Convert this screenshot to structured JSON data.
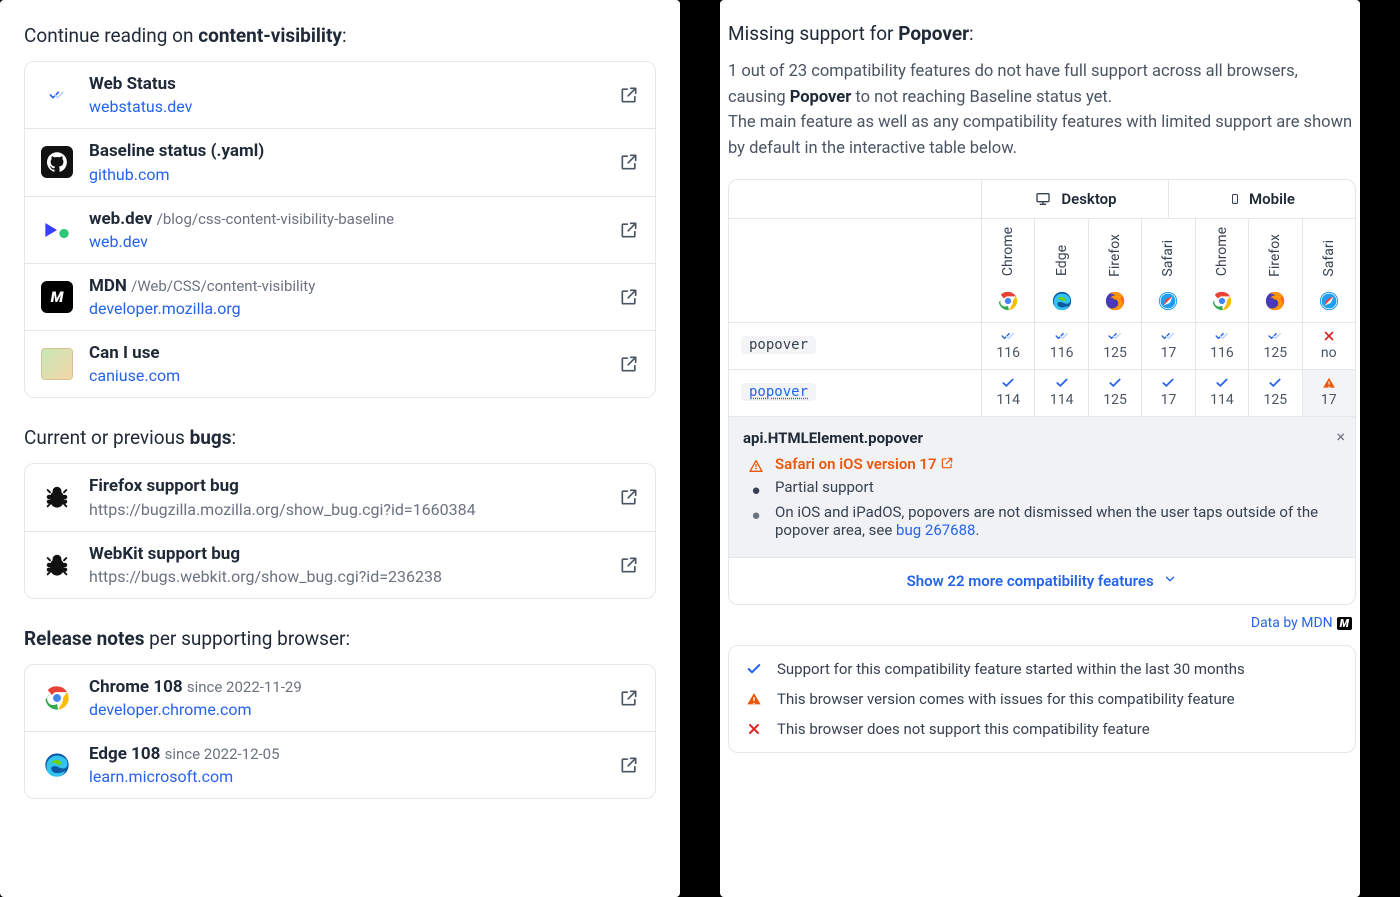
{
  "left": {
    "continue": {
      "heading_pre": "Continue reading on ",
      "heading_bold": "content-visibility",
      "heading_suffix": ":",
      "items": [
        {
          "icon": "webstatus",
          "title": "Web Status",
          "path": "",
          "sub": "webstatus.dev",
          "sub_link": true
        },
        {
          "icon": "github",
          "title": "Baseline status (.yaml)",
          "path": "",
          "sub": "github.com",
          "sub_link": true
        },
        {
          "icon": "webdev",
          "title": "web.dev",
          "path": "/blog/css-content-visibility-baseline",
          "sub": "web.dev",
          "sub_link": true
        },
        {
          "icon": "mdn",
          "title": "MDN",
          "path": "/Web/CSS/content-visibility",
          "sub": "developer.mozilla.org",
          "sub_link": true
        },
        {
          "icon": "caniuse",
          "title": "Can I use",
          "path": "",
          "sub": "caniuse.com",
          "sub_link": true
        }
      ]
    },
    "bugs": {
      "heading_pre": "Current or previous ",
      "heading_bold": "bugs",
      "heading_suffix": ":",
      "items": [
        {
          "icon": "bug",
          "title": "Firefox support bug",
          "sub": "https://bugzilla.mozilla.org/show_bug.cgi?id=1660384"
        },
        {
          "icon": "bug",
          "title": "WebKit support bug",
          "sub": "https://bugs.webkit.org/show_bug.cgi?id=236238"
        }
      ]
    },
    "releases": {
      "heading_bold": "Release notes",
      "heading_rest": " per supporting browser:",
      "items": [
        {
          "icon": "chrome",
          "title": "Chrome 108",
          "since": "since 2022-11-29",
          "sub": "developer.chrome.com"
        },
        {
          "icon": "edge",
          "title": "Edge 108",
          "since": "since 2022-12-05",
          "sub": "learn.microsoft.com"
        }
      ]
    }
  },
  "right": {
    "heading_pre": "Missing support for ",
    "heading_bold": "Popover",
    "heading_suffix": ":",
    "para1_a": "1 out of 23 compatibility features do not have full support across all browsers, causing ",
    "para1_bold": "Popover",
    "para1_b": " to not reaching Baseline status yet.",
    "para2": "The main feature as well as any compatibility features with limited support are shown by default in the interactive table below.",
    "groups": {
      "desktop": "Desktop",
      "mobile": "Mobile"
    },
    "browsers": [
      "Chrome",
      "Edge",
      "Firefox",
      "Safari",
      "Chrome",
      "Firefox",
      "Safari"
    ],
    "browser_icons": [
      "chrome",
      "edge",
      "firefox",
      "safari",
      "chrome",
      "firefox",
      "safari"
    ],
    "rows": [
      {
        "label": "popover",
        "link": false,
        "cells": [
          {
            "s": "base",
            "v": "116"
          },
          {
            "s": "base",
            "v": "116"
          },
          {
            "s": "base",
            "v": "125"
          },
          {
            "s": "base",
            "v": "17"
          },
          {
            "s": "base",
            "v": "116"
          },
          {
            "s": "base",
            "v": "125"
          },
          {
            "s": "no",
            "v": "no"
          }
        ]
      },
      {
        "label": "popover",
        "link": true,
        "cells": [
          {
            "s": "yes",
            "v": "114"
          },
          {
            "s": "yes",
            "v": "114"
          },
          {
            "s": "yes",
            "v": "125"
          },
          {
            "s": "yes",
            "v": "17"
          },
          {
            "s": "yes",
            "v": "114"
          },
          {
            "s": "yes",
            "v": "125"
          },
          {
            "s": "warn",
            "v": "17"
          }
        ]
      }
    ],
    "detail": {
      "title": "api.HTMLElement.popover",
      "safari_line": "Safari on iOS version 17",
      "partial": "Partial support",
      "note_a": "On iOS and iPadOS, popovers are not dismissed when the user taps outside of the popover area, see ",
      "note_link": "bug 267688",
      "note_b": "."
    },
    "show_more": "Show 22 more compatibility features",
    "attrib": "Data by MDN",
    "legend": [
      {
        "sym": "yes",
        "text": "Support for this compatibility feature started within the last 30 months"
      },
      {
        "sym": "warn",
        "text": "This browser version comes with issues for this compatibility feature"
      },
      {
        "sym": "no",
        "text": "This browser does not support this compatibility feature"
      }
    ]
  }
}
